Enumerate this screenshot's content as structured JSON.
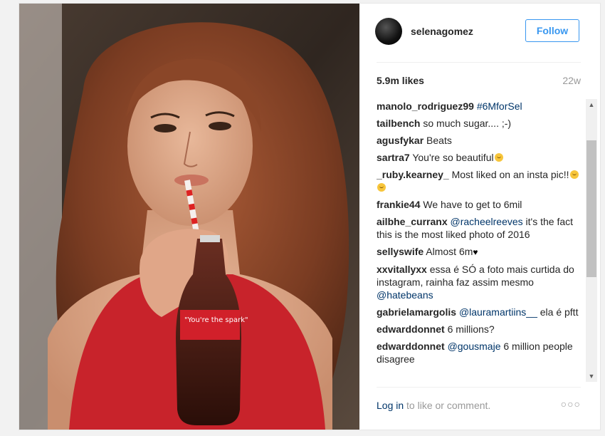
{
  "post": {
    "username": "selenagomez",
    "follow_label": "Follow",
    "likes": "5.9m likes",
    "age": "22w",
    "comments": [
      {
        "user": "manolo_rodriguez99",
        "parts": [
          {
            "t": "#6MforSel",
            "link": true
          }
        ]
      },
      {
        "user": "tailbench",
        "parts": [
          {
            "t": "so much sugar.... ;-)"
          }
        ]
      },
      {
        "user": "agusfykar",
        "parts": [
          {
            "t": "Beats"
          }
        ]
      },
      {
        "user": "sartra7",
        "parts": [
          {
            "t": "You're so beautiful"
          }
        ],
        "emoji": [
          "smile"
        ]
      },
      {
        "user": "_ruby.kearney_",
        "parts": [
          {
            "t": "Most liked on an insta pic!!"
          }
        ],
        "emoji": [
          "wow",
          "smile"
        ]
      },
      {
        "user": "frankie44",
        "parts": [
          {
            "t": "We have to get to 6mil"
          }
        ]
      },
      {
        "user": "ailbhe_curranx",
        "parts": [
          {
            "t": "@racheelreeves",
            "link": true
          },
          {
            "t": " it's the fact this is the most liked photo of 2016"
          }
        ]
      },
      {
        "user": "sellyswife",
        "parts": [
          {
            "t": "Almost 6m"
          }
        ],
        "heart": true
      },
      {
        "user": "xxvitallyxx",
        "parts": [
          {
            "t": "essa é SÓ a foto mais curtida do instagram, rainha faz assim mesmo "
          },
          {
            "t": "@hatebeans",
            "link": true
          }
        ]
      },
      {
        "user": "gabrielamargolis",
        "parts": [
          {
            "t": "@lauramartiins__",
            "link": true
          },
          {
            "t": " ela é pftt"
          }
        ]
      },
      {
        "user": "edwarddonnet",
        "parts": [
          {
            "t": "6 millions?"
          }
        ]
      },
      {
        "user": "edwarddonnet",
        "parts": [
          {
            "t": "@gousmaje",
            "link": true
          },
          {
            "t": " 6 million people disagree"
          }
        ]
      }
    ],
    "login_link": "Log in",
    "login_text": " to like or comment.",
    "more_label": "○○○",
    "bottle_text": "\"You're the spark\""
  },
  "icons": {
    "scroll_up": "▲",
    "scroll_down": "▼"
  }
}
